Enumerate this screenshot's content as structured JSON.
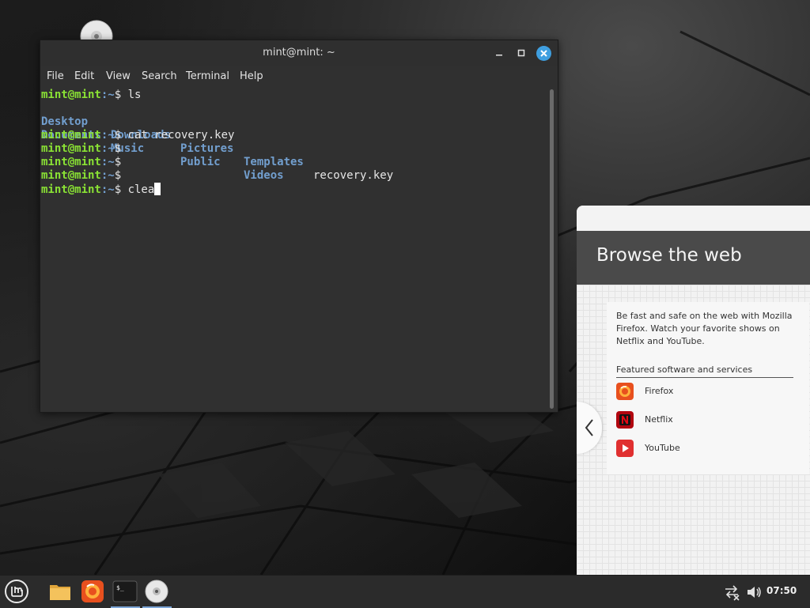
{
  "terminal": {
    "title": "mint@mint: ~",
    "menu": [
      "File",
      "Edit",
      "View",
      "Search",
      "Terminal",
      "Help"
    ],
    "prompt_user": "mint@mint",
    "prompt_path": ":~",
    "prompt_symbol": "$ ",
    "lines": {
      "cmd1": "ls",
      "cmd2": "cat recovery.key",
      "cmd6": "clea"
    },
    "ls_output": {
      "row1": [
        "Desktop",
        "Downloads",
        "Pictures",
        "Templates"
      ],
      "row1_file": "recovery.key",
      "row2": [
        "Documents",
        "Music",
        "Public",
        "Videos"
      ]
    }
  },
  "welcome": {
    "heading": "Browse the web",
    "description": "Be fast and safe on the web with Mozilla Firefox. Watch your favorite shows on Netflix and YouTube.",
    "featured_label": "Featured software and services",
    "apps": [
      {
        "label": "Firefox",
        "icon": "firefox-icon",
        "color": "#e8501e"
      },
      {
        "label": "Netflix",
        "icon": "netflix-icon",
        "color": "#b1060f"
      },
      {
        "label": "YouTube",
        "icon": "youtube-icon",
        "color": "#e03030"
      }
    ]
  },
  "taskbar": {
    "clock": "07:50",
    "items": [
      "mint-menu-icon",
      "files-icon",
      "firefox-icon",
      "terminal-icon",
      "disc-icon"
    ],
    "accent": "#7ea6d8"
  }
}
